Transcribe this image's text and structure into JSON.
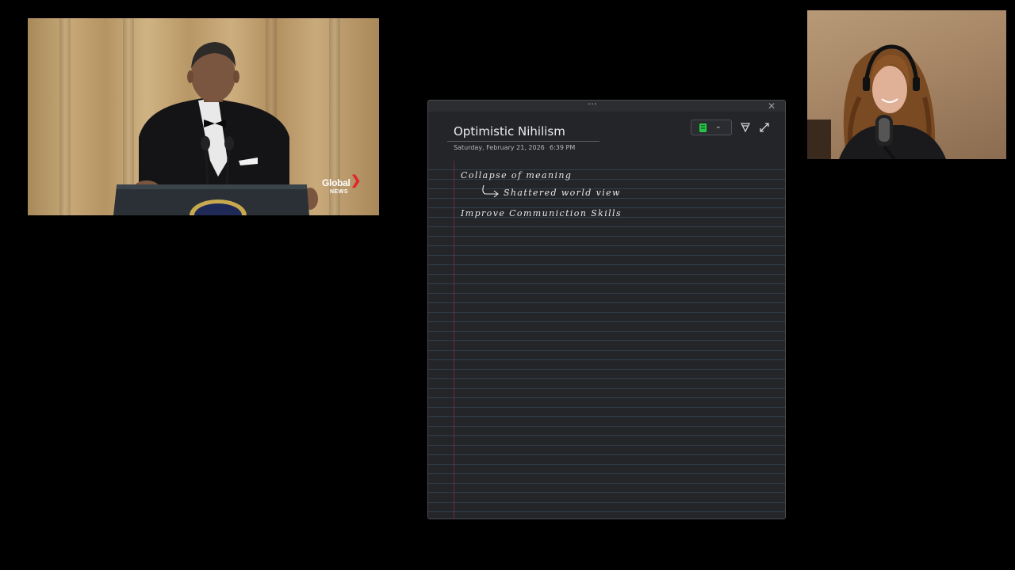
{
  "video_left": {
    "logo_text_1": "Global",
    "logo_text_2": "NEWS"
  },
  "note": {
    "title": "Optimistic Nihilism",
    "date": "Saturday, February 21, 2026",
    "time": "6:39 PM",
    "color_swatch": "#27c44a",
    "ink_lines": [
      "Collapse of meaning",
      "Shattered world view",
      "Improve Communiction Skills"
    ],
    "icons": {
      "drag": "drag-dots-icon",
      "close": "close-icon",
      "color": "notebook-color-icon",
      "pen": "pen-tool-icon",
      "expand": "expand-icon"
    }
  },
  "colors": {
    "background": "#000000",
    "note_bg": "#232529",
    "rule_line": "#34404f",
    "margin_line": "#6b2c33"
  }
}
